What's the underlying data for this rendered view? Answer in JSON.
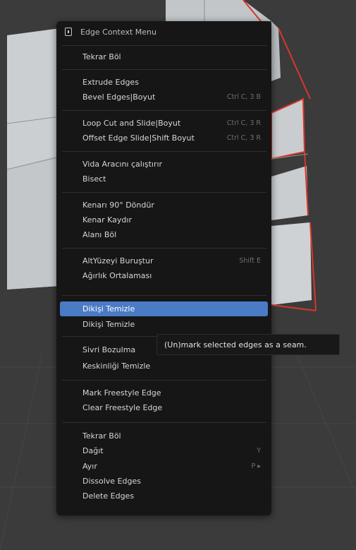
{
  "menu": {
    "title": "Edge Context Menu",
    "items": [
      {
        "label": "Tekrar Böl",
        "shortcut": ""
      },
      {
        "label": "Extrude Edges",
        "shortcut": ""
      },
      {
        "label": "Bevel Edges|Boyut",
        "shortcut": "Ctrl C, 3 B"
      },
      {
        "label": "Loop Cut and Slide|Boyut",
        "shortcut": "Ctrl C, 3 R"
      },
      {
        "label": "Offset Edge Slide|Shift Boyut",
        "shortcut": "Ctrl C, 3 R"
      },
      {
        "label": "Vida Aracını çalıştırır",
        "shortcut": ""
      },
      {
        "label": "Bisect",
        "shortcut": ""
      },
      {
        "label": "Kenarı 90° Döndür",
        "shortcut": ""
      },
      {
        "label": "Kenar Kaydır",
        "shortcut": ""
      },
      {
        "label": "Alanı Böl",
        "shortcut": ""
      },
      {
        "label": "AltYüzeyi Buruştur",
        "shortcut": "Shift E"
      },
      {
        "label": "Ağırlık Ortalaması",
        "shortcut": ""
      },
      {
        "label": "Dikişi Temizle",
        "shortcut": ""
      },
      {
        "label": "Dikişi Temizle",
        "shortcut": ""
      },
      {
        "label": "Sivri Bozulma",
        "shortcut": ""
      },
      {
        "label": "Keskinliği Temizle",
        "shortcut": ""
      },
      {
        "label": "Mark Freestyle Edge",
        "shortcut": ""
      },
      {
        "label": "Clear Freestyle Edge",
        "shortcut": ""
      },
      {
        "label": "Tekrar Böl",
        "shortcut": ""
      },
      {
        "label": "Dağıt",
        "shortcut": "Y"
      },
      {
        "label": "Ayır",
        "shortcut": "P ▸"
      },
      {
        "label": "Dissolve Edges",
        "shortcut": ""
      },
      {
        "label": "Delete Edges",
        "shortcut": ""
      }
    ]
  },
  "tooltip": {
    "text": "(Un)mark selected edges as a seam."
  },
  "colors": {
    "menu_bg": "#161616",
    "highlight": "#4a7bc5",
    "edge_selected": "#d8372b",
    "face": "#c9cdd0"
  }
}
